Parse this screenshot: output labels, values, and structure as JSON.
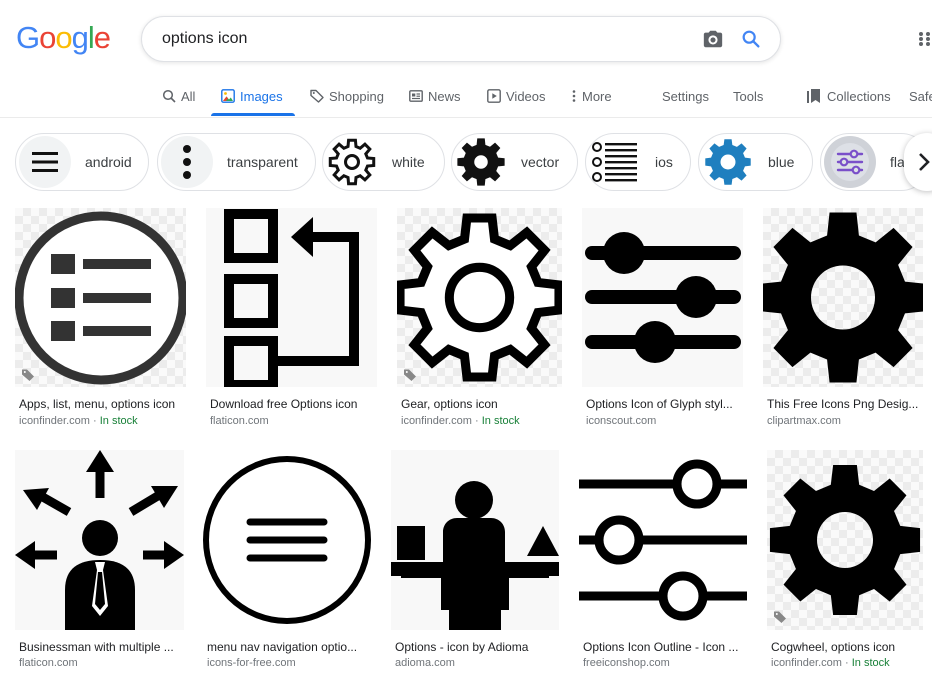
{
  "logo": {
    "letters": [
      "G",
      "o",
      "o",
      "g",
      "l",
      "e"
    ],
    "colors": [
      "#4285F4",
      "#EA4335",
      "#FBBC05",
      "#4285F4",
      "#34A853",
      "#EA4335"
    ]
  },
  "search": {
    "value": "options icon",
    "camera_icon": "camera-icon",
    "search_icon": "magnifier-icon"
  },
  "tabs": [
    {
      "label": "All",
      "icon": "search-icon"
    },
    {
      "label": "Images",
      "icon": "image-icon",
      "active": true
    },
    {
      "label": "Shopping",
      "icon": "tag-icon"
    },
    {
      "label": "News",
      "icon": "newspaper-icon"
    },
    {
      "label": "Videos",
      "icon": "play-icon"
    },
    {
      "label": "More",
      "icon": "kebab-icon"
    },
    {
      "label": "Settings"
    },
    {
      "label": "Tools"
    },
    {
      "label": "Collections",
      "icon": "bookmark-icon"
    },
    {
      "label": "Safe"
    }
  ],
  "chips": [
    {
      "label": "android",
      "icon": "hamburger-icon"
    },
    {
      "label": "transparent",
      "icon": "vertical-dots-icon"
    },
    {
      "label": "white",
      "icon": "gear-outline-icon"
    },
    {
      "label": "vector",
      "icon": "gear-solid-icon"
    },
    {
      "label": "ios",
      "icon": "list-icon"
    },
    {
      "label": "blue",
      "icon": "blue-gear-icon"
    },
    {
      "label": "flat",
      "icon": "sliders-icon"
    }
  ],
  "chip_arrow_icon": "chevron-right-icon",
  "results": [
    {
      "title": "Apps, list, menu, options icon",
      "source": "iconfinder.com",
      "in_stock": "In stock",
      "icon": "circle-list-icon"
    },
    {
      "title": "Download free Options icon",
      "source": "flaticon.com",
      "icon": "boxes-arrow-icon"
    },
    {
      "title": "Gear, options icon",
      "source": "iconfinder.com",
      "in_stock": "In stock",
      "icon": "gear-outline-icon"
    },
    {
      "title": "Options Icon of Glyph styl...",
      "source": "iconscout.com",
      "icon": "sliders-icon"
    },
    {
      "title": "This Free Icons Png Desig...",
      "source": "clipartmax.com",
      "icon": "gear-solid-icon"
    },
    {
      "title": "Businessman with multiple ...",
      "source": "flaticon.com",
      "icon": "businessman-arrows-icon"
    },
    {
      "title": "menu nav navigation optio...",
      "source": "icons-for-free.com",
      "icon": "circle-menu-icon"
    },
    {
      "title": "Options - icon by Adioma",
      "source": "adioma.com",
      "icon": "person-choice-icon"
    },
    {
      "title": "Options Icon Outline - Icon ...",
      "source": "freeiconshop.com",
      "icon": "sliders-outline-icon"
    },
    {
      "title": "Cogwheel, options icon",
      "source": "iconfinder.com",
      "in_stock": "In stock",
      "icon": "cogwheel-icon"
    }
  ]
}
